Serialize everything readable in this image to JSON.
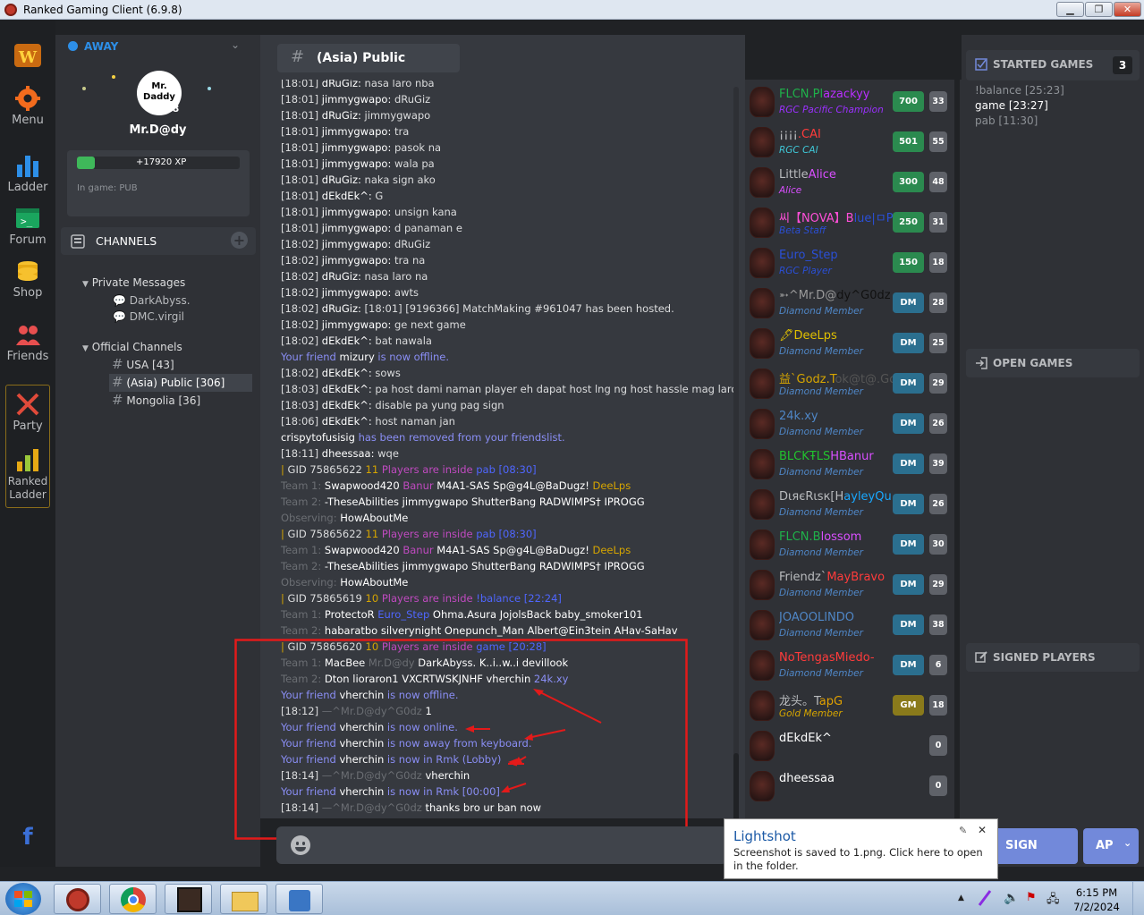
{
  "window": {
    "title": "Ranked Gaming Client (6.9.8)"
  },
  "rail": {
    "menu": "Menu",
    "ladder": "Ladder",
    "forum": "Forum",
    "shop": "Shop",
    "friends": "Friends",
    "party": "Party",
    "ranked_ladder_1": "Ranked",
    "ranked_ladder_2": "Ladder",
    "facebook": "f"
  },
  "user": {
    "status": "AWAY",
    "name": "Mr.D@dy",
    "level": "28",
    "xp": "+17920 XP",
    "xp_fill": 0.45,
    "ingame": "In game: PUB",
    "avatar_text": "Mr. Daddy"
  },
  "channels": {
    "header": "CHANNELS",
    "private_label": "Private Messages",
    "private": [
      "DarkAbyss.",
      "DMC.virgil"
    ],
    "official_label": "Official Channels",
    "official": [
      "USA [43]",
      "(Asia) Public [306]",
      "Mongolia [36]"
    ]
  },
  "chat": {
    "title": "(Asia) Public",
    "lines": [
      {
        "ts": "[18:01]",
        "nm": "dRuGiz:",
        "msg": "nasa laro nba"
      },
      {
        "ts": "[18:01]",
        "nm": "jimmygwapo:",
        "msg": "dRuGiz"
      },
      {
        "ts": "[18:01]",
        "nm": "dRuGiz:",
        "msg": "jimmygwapo"
      },
      {
        "ts": "[18:01]",
        "nm": "jimmygwapo:",
        "msg": "tra"
      },
      {
        "ts": "[18:01]",
        "nm": "jimmygwapo:",
        "msg": "pasok na"
      },
      {
        "ts": "[18:01]",
        "nm": "jimmygwapo:",
        "msg": "wala pa"
      },
      {
        "ts": "[18:01]",
        "nm": "dRuGiz:",
        "msg": "naka sign ako"
      },
      {
        "ts": "[18:01]",
        "nm": "dEkdEk^:",
        "msg": "G"
      },
      {
        "ts": "[18:01]",
        "nm": "jimmygwapo:",
        "msg": "unsign kana"
      },
      {
        "ts": "[18:01]",
        "nm": "jimmygwapo:",
        "msg": "d panaman e"
      },
      {
        "ts": "[18:02]",
        "nm": "jimmygwapo:",
        "msg": "dRuGiz"
      },
      {
        "ts": "[18:02]",
        "nm": "jimmygwapo:",
        "msg": "tra na"
      },
      {
        "ts": "[18:02]",
        "nm": "dRuGiz:",
        "msg": "nasa laro na"
      },
      {
        "ts": "[18:02]",
        "nm": "jimmygwapo:",
        "msg": "awts"
      },
      {
        "ts": "[18:02]",
        "nm": "dRuGiz:",
        "msg": "[18:01] [9196366] MatchMaking #961047 has been hosted."
      },
      {
        "ts": "[18:02]",
        "nm": "jimmygwapo:",
        "msg": "ge next game"
      },
      {
        "ts": "[18:02]",
        "nm": "dEkdEk^:",
        "msg": "bat nawala"
      }
    ],
    "lines2": [
      {
        "ts": "[18:02]",
        "nm": "dEkdEk^:",
        "msg": "sows"
      },
      {
        "ts": "[18:03]",
        "nm": "dEkdEk^:",
        "msg": "pa host dami naman player eh dapat host lng ng host hassle mag laro"
      },
      {
        "ts": "[18:03]",
        "nm": "dEkdEk^:",
        "msg": "disable pa yung pag sign"
      },
      {
        "ts": "[18:06]",
        "nm": "dEkdEk^:",
        "msg": "host naman jan"
      }
    ],
    "friend_offline_mizury": [
      "Your friend",
      "mizury",
      "is now offline."
    ],
    "removed": [
      "crispytofusisig",
      "has been removed from your friendslist."
    ],
    "dheessaa": {
      "ts": "[18:11]",
      "nm": "dheessaa:",
      "msg": "wqe"
    },
    "game_blocks": [
      {
        "gid": "GID 75865622",
        "players": "11",
        "info": "Players are inside",
        "name": "pab [08:30]",
        "team1": [
          "Swapwood420",
          "Banur",
          "M4A1-SAS",
          "Sp@g4L@BaDugz!",
          "DeeLps"
        ],
        "team2": [
          "-TheseAbilities",
          "jimmygwapo",
          "ShutterBang",
          "RADWIMPS†",
          "IPROGG"
        ],
        "observing": "HowAboutMe"
      },
      {
        "gid": "GID 75865622",
        "players": "11",
        "info": "Players are inside",
        "name": "pab [08:30]",
        "team1": [
          "Swapwood420",
          "Banur",
          "M4A1-SAS",
          "Sp@g4L@BaDugz!",
          "DeeLps"
        ],
        "team2": [
          "-TheseAbilities",
          "jimmygwapo",
          "ShutterBang",
          "RADWIMPS†",
          "IPROGG"
        ],
        "observing": "HowAboutMe"
      }
    ],
    "game3": {
      "gid": "GID 75865619",
      "players": "10",
      "info": "Players are inside",
      "name": "!balance [22:24]",
      "team1": [
        "ProtectoR",
        "Euro_Step",
        "Ohma.Asura",
        "JojolsBack",
        "baby_smoker101"
      ],
      "team2": [
        "habaratbo",
        "silverynight",
        "Onepunch_Man",
        "Albert@Ein3tein",
        "AHav-SaHav"
      ]
    },
    "game4": {
      "gid": "GID 75865620",
      "players": "10",
      "info": "Players are inside",
      "name": "game [20:28]",
      "team1": [
        "MacBee",
        "Mr.D@dy",
        "DarkAbyss.",
        "K..i..w..i",
        "devillook"
      ],
      "team2": [
        "Dton",
        "lioraron1",
        "VXCRTWSKJNHF",
        "vherchin",
        "24k.xy"
      ]
    },
    "labels": {
      "team1": "Team 1:",
      "team2": "Team 2:",
      "observing": "Observing:"
    },
    "tail": [
      {
        "kind": "friend",
        "a": "Your friend",
        "b": "vherchin",
        "c": "is now offline."
      },
      {
        "kind": "msg",
        "ts": "[18:12]",
        "nm": "—^Mr.D@dy^G0dz",
        "msg": "1"
      },
      {
        "kind": "friend",
        "a": "Your friend",
        "b": "vherchin",
        "c": "is now online."
      },
      {
        "kind": "friend",
        "a": "Your friend",
        "b": "vherchin",
        "c": "is now away from keyboard."
      },
      {
        "kind": "friend",
        "a": "Your friend",
        "b": "vherchin",
        "c": "is now in Rmk (Lobby)"
      },
      {
        "kind": "msg",
        "ts": "[18:14]",
        "nm": "—^Mr.D@dy^G0dz",
        "msg": "vherchin"
      },
      {
        "kind": "friend",
        "a": "Your friend",
        "b": "vherchin",
        "c": "is now in Rmk [00:00]"
      },
      {
        "kind": "msg",
        "ts": "[18:14]",
        "nm": "—^Mr.D@dy^G0dz",
        "msg": "thanks bro ur ban now"
      }
    ]
  },
  "players": [
    {
      "name": "FLCN.Plazackyy",
      "sub": "RGC Pacific Champion",
      "badge": "700",
      "count": "33",
      "c1": "#1fb14a",
      "c2": "#b92eff",
      "sc": "#9b30ff",
      "bc": "#2b8a4f"
    },
    {
      "name": "¡¡¡¡.CAI",
      "sub": "RGC CAI",
      "badge": "501",
      "count": "55",
      "c1": "#b9bbbe",
      "c2": "#ff3b3b",
      "sc": "#3fc6d6",
      "bc": "#2b8a4f"
    },
    {
      "name": "LittleAlice",
      "sub": "Alice",
      "badge": "300",
      "count": "48",
      "c1": "#b9bbbe",
      "c2": "#d94fff",
      "sc": "#d94fff",
      "bc": "#2b8a4f"
    },
    {
      "name": "씨【NOVA】Blue|ㅁPOR",
      "sub": "Beta Staff",
      "badge": "250",
      "count": "31",
      "c1": "#ff4fd8",
      "c2": "#2a4fd6",
      "sc": "#2a4fd6",
      "bc": "#2b8a4f"
    },
    {
      "name": "Euro_Step",
      "sub": "RGC Player",
      "badge": "150",
      "count": "18",
      "c1": "#2a4fd6",
      "c2": "#2a4fd6",
      "sc": "#2a4fd6",
      "bc": "#2b8a4f"
    },
    {
      "name": "➵^Mr.D@dy^G0dz",
      "sub": "Diamond Member",
      "badge": "DM",
      "count": "28",
      "c1": "#9a9a9a",
      "c2": "#111111",
      "sc": "#4f86c6",
      "bc": "#2b6f8f"
    },
    {
      "name": "🖋DeeLps",
      "sub": "Diamond Member",
      "badge": "DM",
      "count": "25",
      "c1": "#e0c000",
      "c2": "#e0c000",
      "sc": "#4f86c6",
      "bc": "#2b6f8f"
    },
    {
      "name": "益`Godz.Tok@t@.Go",
      "sub": "Diamond Member",
      "badge": "DM",
      "count": "29",
      "c1": "#d6a500",
      "c2": "#555555",
      "sc": "#4f86c6",
      "bc": "#2b6f8f"
    },
    {
      "name": "24k.xy",
      "sub": "Diamond Member",
      "badge": "DM",
      "count": "26",
      "c1": "#4f86c6",
      "c2": "#4f86c6",
      "sc": "#4f86c6",
      "bc": "#2b6f8f"
    },
    {
      "name": "BLCKŦLSHBanur",
      "sub": "Diamond Member",
      "badge": "DM",
      "count": "39",
      "c1": "#22c22e",
      "c2": "#d94fff",
      "sc": "#4f86c6",
      "bc": "#2b6f8f"
    },
    {
      "name": "DιяєRιѕк[HayleyQuir",
      "sub": "Diamond Member",
      "badge": "DM",
      "count": "26",
      "c1": "#b9bbbe",
      "c2": "#18a8ff",
      "sc": "#4f86c6",
      "bc": "#2b6f8f"
    },
    {
      "name": "FLCN.Blossom",
      "sub": "Diamond Member",
      "badge": "DM",
      "count": "30",
      "c1": "#1fb14a",
      "c2": "#d94fff",
      "sc": "#4f86c6",
      "bc": "#2b6f8f"
    },
    {
      "name": "Friendz`MayBravo",
      "sub": "Diamond Member",
      "badge": "DM",
      "count": "29",
      "c1": "#b9bbbe",
      "c2": "#ff3b3b",
      "sc": "#4f86c6",
      "bc": "#2b6f8f"
    },
    {
      "name": "JOAOOLINDO",
      "sub": "Diamond Member",
      "badge": "DM",
      "count": "38",
      "c1": "#4f86c6",
      "c2": "#4f86c6",
      "sc": "#4f86c6",
      "bc": "#2b6f8f"
    },
    {
      "name": "NoTengasMiedo-",
      "sub": "Diamond Member",
      "badge": "DM",
      "count": "6",
      "c1": "#ff3b3b",
      "c2": "#ff3b3b",
      "sc": "#4f86c6",
      "bc": "#2b6f8f"
    },
    {
      "name": "龙头。TapG",
      "sub": "Gold Member",
      "badge": "GM",
      "count": "18",
      "c1": "#b9bbbe",
      "c2": "#e0a000",
      "sc": "#d6a500",
      "bc": "#8a7a1b"
    },
    {
      "name": "dEkdEk^",
      "sub": "",
      "badge": "",
      "count": "0",
      "c1": "#ffffff",
      "c2": "#ffffff",
      "sc": "#ffffff",
      "bc": "#2f3136"
    },
    {
      "name": "dheessaa",
      "sub": "",
      "badge": "",
      "count": "0",
      "c1": "#ffffff",
      "c2": "#ffffff",
      "sc": "#ffffff",
      "bc": "#2f3136"
    }
  ],
  "right": {
    "started_title": "STARTED GAMES",
    "started_count": "3",
    "started": [
      "!balance [25:23]",
      "game [23:27]",
      "pab [11:30]"
    ],
    "open_title": "OPEN GAMES",
    "signed_title": "SIGNED PLAYERS",
    "sign_btn": "SIGN",
    "ap_btn": "AP"
  },
  "toast": {
    "title": "Lightshot",
    "body": "Screenshot is saved to 1.png. Click here to open in the folder."
  },
  "taskbar": {
    "time": "6:15 PM",
    "date": "7/2/2024"
  }
}
